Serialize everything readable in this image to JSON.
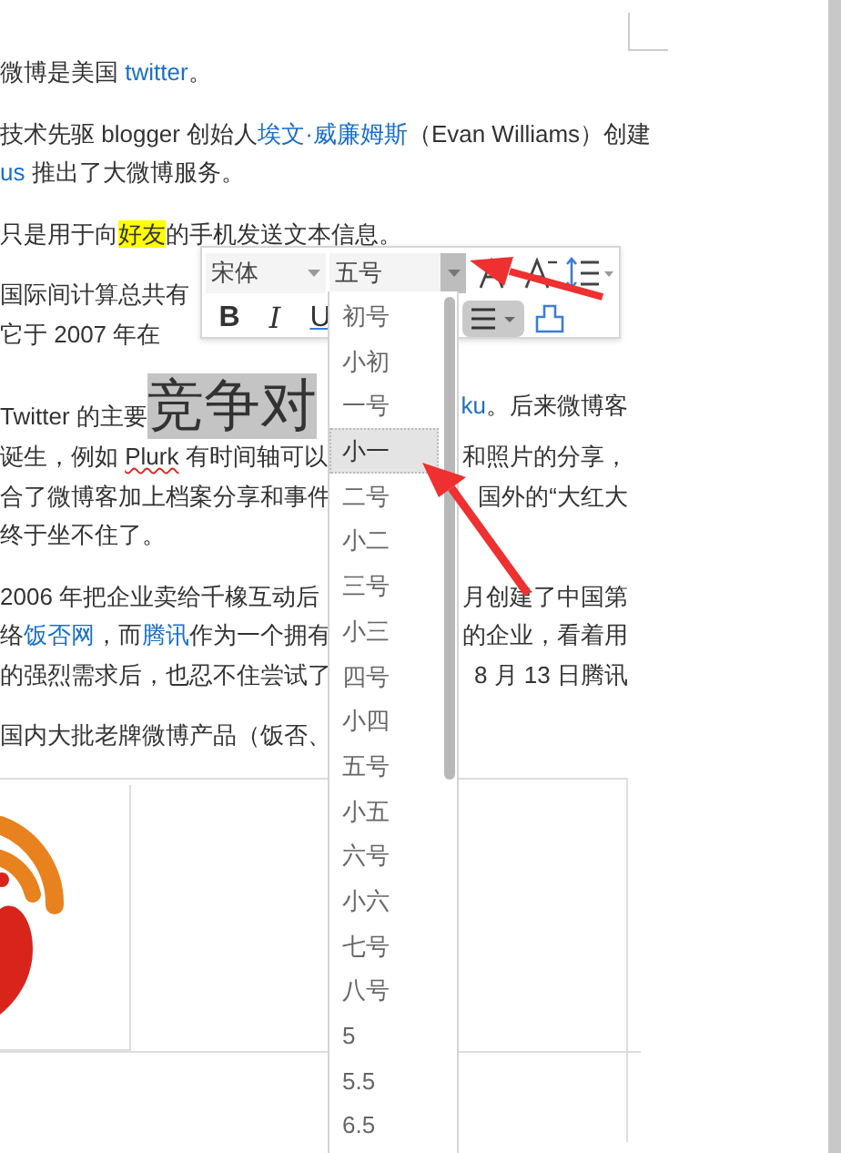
{
  "document": {
    "paragraphs": [
      {
        "lines": [
          {
            "left": [
              {
                "kind": "plain",
                "text": "微博是美国 "
              },
              {
                "kind": "link",
                "text": "twitter"
              },
              {
                "kind": "plain",
                "text": "。"
              }
            ]
          }
        ]
      },
      {
        "lines": [
          {
            "left": [
              {
                "kind": "plain",
                "text": "技术先驱 blogger 创始人"
              },
              {
                "kind": "link",
                "text": "埃文·威廉姆斯"
              },
              {
                "kind": "plain",
                "text": "（Evan Williams）创建"
              }
            ]
          },
          {
            "left": [
              {
                "kind": "link",
                "text": "us"
              },
              {
                "kind": "plain",
                "text": " 推出了大微博服务。"
              }
            ]
          }
        ]
      },
      {
        "lines": [
          {
            "left": [
              {
                "kind": "plain",
                "text": "只是用于向"
              },
              {
                "kind": "highlight",
                "text": "好友"
              },
              {
                "kind": "plain",
                "text": "的手机发送文本信息。"
              }
            ]
          }
        ]
      },
      {
        "lines": [
          {
            "left": [
              {
                "kind": "plain",
                "text": "国际间计算总共有"
              }
            ]
          },
          {
            "left": [
              {
                "kind": "plain",
                "text": "它于 2007 年在"
              }
            ]
          }
        ]
      },
      {
        "lines": [
          {
            "left": [
              {
                "kind": "plain",
                "text": "Twitter 的主要"
              },
              {
                "kind": "selection",
                "text": "竞争对"
              }
            ],
            "right": [
              {
                "kind": "link",
                "text": "ku"
              },
              {
                "kind": "plain",
                "text": "。后来微博客"
              }
            ]
          },
          {
            "left": [
              {
                "kind": "plain",
                "text": "诞生，例如 "
              },
              {
                "kind": "misspelled",
                "text": "Plurk"
              },
              {
                "kind": "plain",
                "text": " 有时间轴可以"
              }
            ],
            "right": [
              {
                "kind": "plain",
                "text": "和照片的分享，"
              }
            ]
          },
          {
            "left": [
              {
                "kind": "plain",
                "text": "合了微博客加上档案分享和事件"
              }
            ],
            "right": [
              {
                "kind": "plain",
                "text": "国外的“大红大"
              }
            ]
          },
          {
            "left": [
              {
                "kind": "plain",
                "text": "终于坐不住了。"
              }
            ]
          }
        ]
      },
      {
        "lines": [
          {
            "left": [
              {
                "kind": "plain",
                "text": "2006 年把企业卖给千橡互动后"
              }
            ],
            "right": [
              {
                "kind": "plain",
                "text": "月创建了中国第"
              }
            ]
          },
          {
            "left": [
              {
                "kind": "plain",
                "text": "络"
              },
              {
                "kind": "link",
                "text": "饭否网"
              },
              {
                "kind": "plain",
                "text": "，而"
              },
              {
                "kind": "link",
                "text": "腾讯"
              },
              {
                "kind": "plain",
                "text": "作为一个拥有"
              }
            ],
            "right": [
              {
                "kind": "plain",
                "text": "的企业，看着用"
              }
            ]
          },
          {
            "left": [
              {
                "kind": "plain",
                "text": "的强烈需求后，也忍不住尝试了"
              }
            ],
            "right": [
              {
                "kind": "plain",
                "text": "8 月 13 日腾讯"
              }
            ]
          }
        ]
      },
      {
        "lines": [
          {
            "left": [
              {
                "kind": "plain",
                "text": " 国内大批老牌微博产品（饭否、"
              }
            ]
          }
        ]
      }
    ]
  },
  "toolbar": {
    "font_name": "宋体",
    "font_size": "五号",
    "style_buttons": [
      "B",
      "I",
      "U"
    ]
  },
  "size_dropdown": {
    "items": [
      {
        "label": "初号",
        "selected": false
      },
      {
        "label": "小初",
        "selected": false
      },
      {
        "label": "一号",
        "selected": false
      },
      {
        "label": "小一",
        "selected": true
      },
      {
        "label": "二号",
        "selected": false
      },
      {
        "label": "小二",
        "selected": false
      },
      {
        "label": "三号",
        "selected": false
      },
      {
        "label": "小三",
        "selected": false
      },
      {
        "label": "四号",
        "selected": false
      },
      {
        "label": "小四",
        "selected": false
      },
      {
        "label": "五号",
        "selected": false
      },
      {
        "label": "小五",
        "selected": false
      },
      {
        "label": "六号",
        "selected": false
      },
      {
        "label": "小六",
        "selected": false
      },
      {
        "label": "七号",
        "selected": false
      },
      {
        "label": "八号",
        "selected": false
      },
      {
        "label": "5",
        "selected": false
      },
      {
        "label": "5.5",
        "selected": false
      },
      {
        "label": "6.5",
        "selected": false
      }
    ]
  }
}
